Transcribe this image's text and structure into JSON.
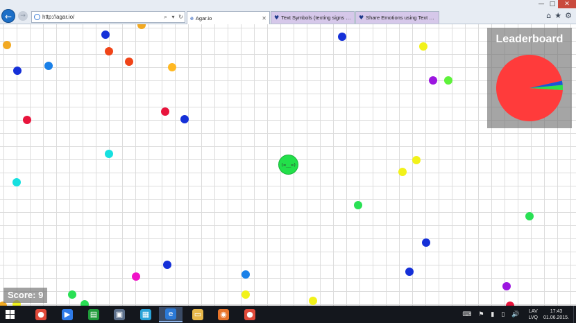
{
  "window": {
    "minimize": "—",
    "maximize": "□",
    "close": "✕"
  },
  "browser": {
    "back_icon": "arrow-left",
    "forward_icon": "arrow-right",
    "address": "http://agar.io/",
    "address_search_glyph": "⌕",
    "address_dropdown_glyph": "▾",
    "address_refresh_glyph": "↻",
    "tabs": [
      {
        "label": "Agar.io",
        "icon": "ie-icon",
        "active": true
      },
      {
        "label": "Text Symbols (texting signs & ...",
        "icon": "heart-icon",
        "active": false
      },
      {
        "label": "Share Emotions using Text Em...",
        "icon": "heart-icon",
        "active": false
      }
    ],
    "tab_close_glyph": "✕",
    "tools": {
      "home": "⌂",
      "favorites": "★",
      "settings": "⚙"
    }
  },
  "game": {
    "leaderboard_title": "Leaderboard",
    "leaderboard_shares": [
      {
        "color": "#ff3b3b",
        "share": 0.955
      },
      {
        "color": "#2fe04a",
        "share": 0.025
      },
      {
        "color": "#1a56d6",
        "share": 0.02
      }
    ],
    "score_text": "Score: 9",
    "player": {
      "name": "(=__=)",
      "color": "#22e04a"
    },
    "pellet_colors": {
      "blue": "#1530d8",
      "orange": "#f2a922",
      "red": "#e8143c",
      "cyan": "#16e0e0",
      "yellow": "#f2f21a",
      "purple": "#9c16e0",
      "green": "#5ef23a",
      "pink": "#f012c8",
      "skyblue": "#1a80e8",
      "darkorange": "#f04418",
      "amber": "#ffb822",
      "lime": "#29e054"
    }
  },
  "taskbar": {
    "apps": [
      {
        "icon": "chrome-icon"
      },
      {
        "icon": "media-player-icon"
      },
      {
        "icon": "store-icon"
      },
      {
        "icon": "picture-viewer-icon"
      },
      {
        "icon": "remote-desktop-icon"
      },
      {
        "icon": "internet-explorer-icon"
      },
      {
        "icon": "file-explorer-icon"
      },
      {
        "icon": "firefox-icon"
      },
      {
        "icon": "chrome-icon"
      }
    ],
    "tray": {
      "keyboard_glyph": "⌨",
      "flag_glyph": "⚑",
      "network_glyph": "▮",
      "battery_glyph": "▯",
      "volume_glyph": "🔊",
      "lang_top": "LAV",
      "lang_bottom": "LVQ",
      "time": "17:43",
      "date": "01.06.2015."
    }
  }
}
